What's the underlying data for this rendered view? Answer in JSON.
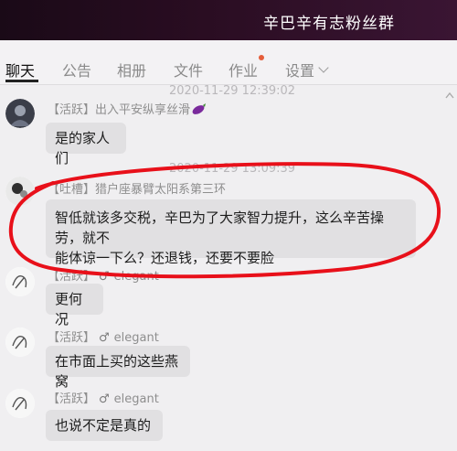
{
  "header": {
    "title": "辛巴辛有志粉丝群"
  },
  "tabs": [
    {
      "label": "聊天"
    },
    {
      "label": "公告"
    },
    {
      "label": "相册"
    },
    {
      "label": "文件"
    },
    {
      "label": "作业"
    },
    {
      "label": "设置"
    }
  ],
  "colors": {
    "title_bar": "#2a0d22",
    "bubble": "#e1e0e2",
    "annotation_circle": "#e8101a",
    "notification_dot": "#e55d3a"
  },
  "messages": [
    {
      "timestamp": "2020-11-29 12:39:02",
      "tag": "【活跃】",
      "name": "出入平安纵享丝滑",
      "name_icon": "eggplant-icon",
      "text": "是的家人们"
    },
    {
      "timestamp": "2020-11-29 13:09:39",
      "tag": "【吐槽】",
      "name": "猎户座暴臂太阳系第三环",
      "text_line1": "智低就该多交税，辛巴为了大家智力提升，这么辛苦操劳，就不",
      "text_line2": "能体谅一下么？还退钱，还要不要脸"
    },
    {
      "tag": "【活跃】",
      "gender": "♂",
      "name": "elegant",
      "text": "更何况"
    },
    {
      "tag": "【活跃】",
      "gender": "♂",
      "name": "elegant",
      "text": "在市面上买的这些燕窝"
    },
    {
      "tag": "【活跃】",
      "gender": "♂",
      "name": "elegant",
      "text": "也说不定是真的"
    }
  ]
}
